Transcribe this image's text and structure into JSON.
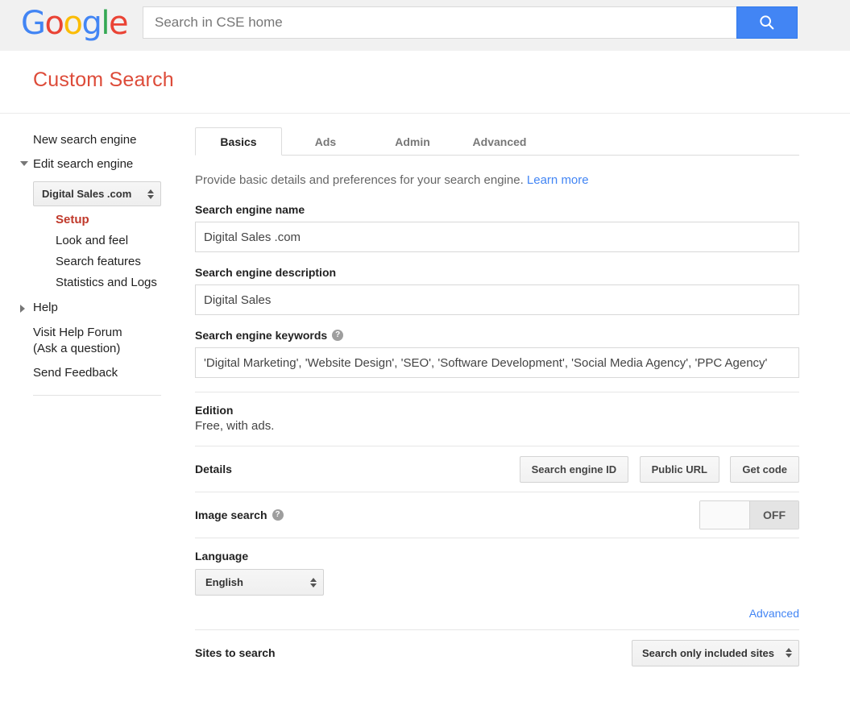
{
  "topbar": {
    "logo_text": "Google",
    "logo_letters": [
      {
        "ch": "G",
        "color": "#4285f4"
      },
      {
        "ch": "o",
        "color": "#ea4335"
      },
      {
        "ch": "o",
        "color": "#fbbc05"
      },
      {
        "ch": "g",
        "color": "#4285f4"
      },
      {
        "ch": "l",
        "color": "#34a853"
      },
      {
        "ch": "e",
        "color": "#ea4335"
      }
    ],
    "search_placeholder": "Search in CSE home",
    "search_value": "",
    "search_button_icon": "search-icon",
    "search_button_color": "#4285f4",
    "background": "#f1f1f1"
  },
  "header": {
    "title": "Custom Search",
    "title_color": "#dd4b39"
  },
  "sidebar": {
    "new_engine": "New search engine",
    "edit_engine": "Edit search engine",
    "engine_selected": "Digital Sales .com",
    "sub_items": [
      {
        "label": "Setup",
        "active": true
      },
      {
        "label": "Look and feel",
        "active": false
      },
      {
        "label": "Search features",
        "active": false
      },
      {
        "label": "Statistics and Logs",
        "active": false
      }
    ],
    "help": "Help",
    "visit_forum_line1": "Visit Help Forum",
    "visit_forum_line2": "(Ask a question)",
    "send_feedback": "Send Feedback",
    "active_color": "#c0392b"
  },
  "main": {
    "tabs": [
      {
        "label": "Basics",
        "active": true
      },
      {
        "label": "Ads",
        "active": false
      },
      {
        "label": "Admin",
        "active": false
      },
      {
        "label": "Advanced",
        "active": false
      }
    ],
    "subtitle_text": "Provide basic details and preferences for your search engine.",
    "subtitle_link": "Learn more",
    "name_label": "Search engine name",
    "name_value": "Digital Sales .com",
    "description_label": "Search engine description",
    "description_value": "Digital Sales",
    "keywords_label": "Search engine keywords",
    "keywords_help_icon": "help-icon",
    "keywords_value": "'Digital Marketing', 'Website Design', 'SEO', 'Software Development', 'Social Media Agency', 'PPC Agency'",
    "edition_label": "Edition",
    "edition_value": "Free, with ads.",
    "details_label": "Details",
    "details_buttons": [
      {
        "label": "Search engine ID"
      },
      {
        "label": "Public URL"
      },
      {
        "label": "Get code"
      }
    ],
    "image_search_label": "Image search",
    "image_search_help_icon": "help-icon",
    "image_search_state": "OFF",
    "language_label": "Language",
    "language_value": "English",
    "advanced_link": "Advanced",
    "sites_label": "Sites to search",
    "sites_value": "Search only included sites",
    "link_color": "#4285f4"
  }
}
